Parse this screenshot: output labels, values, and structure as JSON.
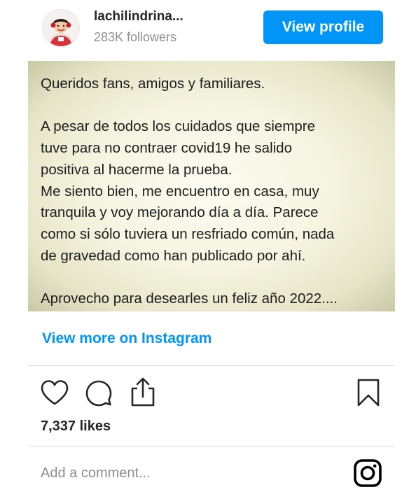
{
  "header": {
    "username": "lachilindrina...",
    "followers": "283K followers",
    "view_profile_label": "View profile"
  },
  "post": {
    "text_lines": [
      "Queridos fans, amigos y familiares.",
      "",
      "A pesar de todos los cuidados que siempre",
      "tuve para no contraer covid19  he salido",
      "positiva al hacerme la prueba.",
      "Me siento bien, me encuentro en casa, muy",
      "tranquila y voy mejorando día a día. Parece",
      "como si sólo tuviera un resfriado común, nada",
      "de gravedad como han publicado por ahí.",
      "",
      "Aprovecho para desearles un feliz año 2022...."
    ]
  },
  "view_more_label": "View more on Instagram",
  "actions": {
    "like_icon": "heart-icon",
    "comment_icon": "comment-icon",
    "share_icon": "share-icon",
    "save_icon": "bookmark-icon"
  },
  "likes_label": "7,337 likes",
  "comment": {
    "placeholder": "Add a comment...",
    "brand_icon": "instagram-icon"
  },
  "colors": {
    "accent": "#0095f6",
    "muted_text": "#8e8e8e",
    "divider": "#dbdbdb"
  }
}
